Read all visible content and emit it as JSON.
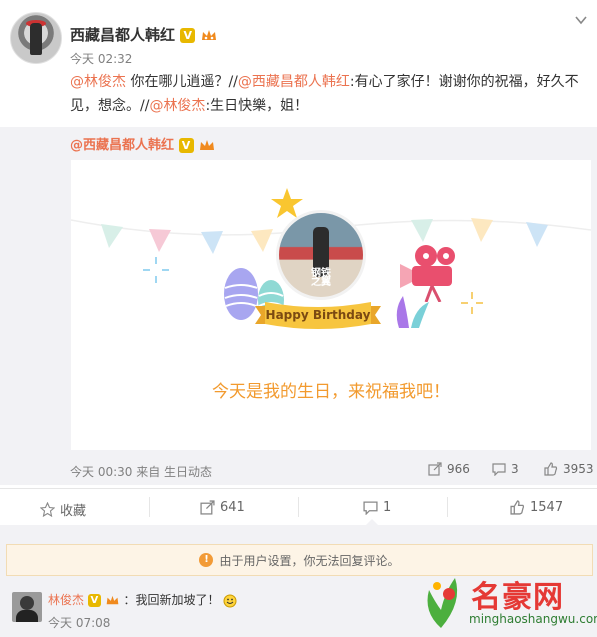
{
  "post": {
    "author": "西藏昌都人韩红",
    "verified_badge": "V",
    "time": "今天 02:32",
    "text_segments": [
      {
        "t": "@林俊杰",
        "link": true
      },
      {
        "t": " 你在哪儿逍遥？//",
        "link": false
      },
      {
        "t": "@西藏昌都人韩红",
        "link": true
      },
      {
        "t": ":有心了家仔！谢谢你的祝福，好久不见，想念。//",
        "link": false
      },
      {
        "t": "@林俊杰",
        "link": true
      },
      {
        "t": ":生日快樂，姐！",
        "link": false
      }
    ]
  },
  "repost": {
    "author": "@西藏昌都人韩红",
    "card": {
      "ribbon_text": "Happy Birthday",
      "message": "今天是我的生日，来祝福我吧！",
      "photo_caption_1": "钢铁",
      "photo_caption_2": "之翼"
    },
    "time_source": "今天 00:30 来自 生日动态",
    "shares": "966",
    "comments": "3",
    "likes": "3953"
  },
  "actions": {
    "favorite": "收藏",
    "forward": "641",
    "comment": "1",
    "like": "1547"
  },
  "notice": "由于用户设置，你无法回复评论。",
  "comment": {
    "author": "林俊杰",
    "verified_badge": "V",
    "text": "：我回新加坡了！",
    "time": "今天 07:08"
  },
  "watermark": {
    "brand": "名豪网",
    "url": "minghaoshangwu.com"
  },
  "colors": {
    "link": "#eb7350",
    "accent_orange": "#f29a2e",
    "verified": "#e8b800",
    "background_gray": "#f2f2f5"
  }
}
